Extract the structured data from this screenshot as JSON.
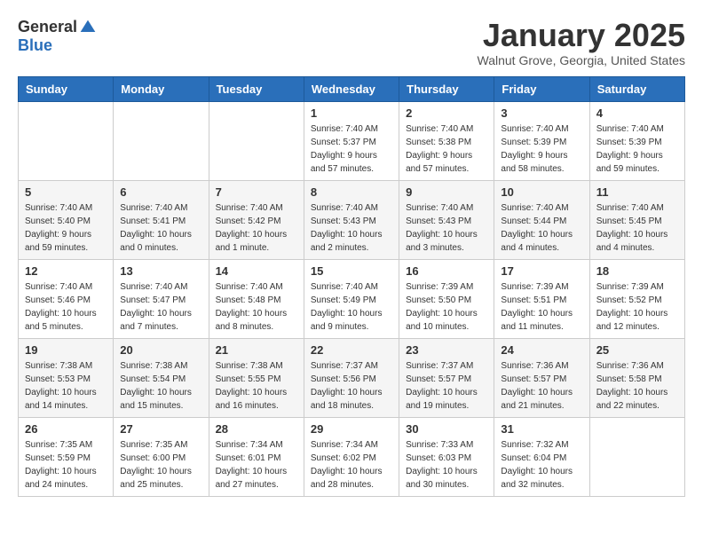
{
  "header": {
    "logo": {
      "general": "General",
      "blue": "Blue"
    },
    "title": "January 2025",
    "location": "Walnut Grove, Georgia, United States"
  },
  "weekdays": [
    "Sunday",
    "Monday",
    "Tuesday",
    "Wednesday",
    "Thursday",
    "Friday",
    "Saturday"
  ],
  "weeks": [
    [
      {
        "day": "",
        "info": ""
      },
      {
        "day": "",
        "info": ""
      },
      {
        "day": "",
        "info": ""
      },
      {
        "day": "1",
        "info": "Sunrise: 7:40 AM\nSunset: 5:37 PM\nDaylight: 9 hours\nand 57 minutes."
      },
      {
        "day": "2",
        "info": "Sunrise: 7:40 AM\nSunset: 5:38 PM\nDaylight: 9 hours\nand 57 minutes."
      },
      {
        "day": "3",
        "info": "Sunrise: 7:40 AM\nSunset: 5:39 PM\nDaylight: 9 hours\nand 58 minutes."
      },
      {
        "day": "4",
        "info": "Sunrise: 7:40 AM\nSunset: 5:39 PM\nDaylight: 9 hours\nand 59 minutes."
      }
    ],
    [
      {
        "day": "5",
        "info": "Sunrise: 7:40 AM\nSunset: 5:40 PM\nDaylight: 9 hours\nand 59 minutes."
      },
      {
        "day": "6",
        "info": "Sunrise: 7:40 AM\nSunset: 5:41 PM\nDaylight: 10 hours\nand 0 minutes."
      },
      {
        "day": "7",
        "info": "Sunrise: 7:40 AM\nSunset: 5:42 PM\nDaylight: 10 hours\nand 1 minute."
      },
      {
        "day": "8",
        "info": "Sunrise: 7:40 AM\nSunset: 5:43 PM\nDaylight: 10 hours\nand 2 minutes."
      },
      {
        "day": "9",
        "info": "Sunrise: 7:40 AM\nSunset: 5:43 PM\nDaylight: 10 hours\nand 3 minutes."
      },
      {
        "day": "10",
        "info": "Sunrise: 7:40 AM\nSunset: 5:44 PM\nDaylight: 10 hours\nand 4 minutes."
      },
      {
        "day": "11",
        "info": "Sunrise: 7:40 AM\nSunset: 5:45 PM\nDaylight: 10 hours\nand 4 minutes."
      }
    ],
    [
      {
        "day": "12",
        "info": "Sunrise: 7:40 AM\nSunset: 5:46 PM\nDaylight: 10 hours\nand 5 minutes."
      },
      {
        "day": "13",
        "info": "Sunrise: 7:40 AM\nSunset: 5:47 PM\nDaylight: 10 hours\nand 7 minutes."
      },
      {
        "day": "14",
        "info": "Sunrise: 7:40 AM\nSunset: 5:48 PM\nDaylight: 10 hours\nand 8 minutes."
      },
      {
        "day": "15",
        "info": "Sunrise: 7:40 AM\nSunset: 5:49 PM\nDaylight: 10 hours\nand 9 minutes."
      },
      {
        "day": "16",
        "info": "Sunrise: 7:39 AM\nSunset: 5:50 PM\nDaylight: 10 hours\nand 10 minutes."
      },
      {
        "day": "17",
        "info": "Sunrise: 7:39 AM\nSunset: 5:51 PM\nDaylight: 10 hours\nand 11 minutes."
      },
      {
        "day": "18",
        "info": "Sunrise: 7:39 AM\nSunset: 5:52 PM\nDaylight: 10 hours\nand 12 minutes."
      }
    ],
    [
      {
        "day": "19",
        "info": "Sunrise: 7:38 AM\nSunset: 5:53 PM\nDaylight: 10 hours\nand 14 minutes."
      },
      {
        "day": "20",
        "info": "Sunrise: 7:38 AM\nSunset: 5:54 PM\nDaylight: 10 hours\nand 15 minutes."
      },
      {
        "day": "21",
        "info": "Sunrise: 7:38 AM\nSunset: 5:55 PM\nDaylight: 10 hours\nand 16 minutes."
      },
      {
        "day": "22",
        "info": "Sunrise: 7:37 AM\nSunset: 5:56 PM\nDaylight: 10 hours\nand 18 minutes."
      },
      {
        "day": "23",
        "info": "Sunrise: 7:37 AM\nSunset: 5:57 PM\nDaylight: 10 hours\nand 19 minutes."
      },
      {
        "day": "24",
        "info": "Sunrise: 7:36 AM\nSunset: 5:57 PM\nDaylight: 10 hours\nand 21 minutes."
      },
      {
        "day": "25",
        "info": "Sunrise: 7:36 AM\nSunset: 5:58 PM\nDaylight: 10 hours\nand 22 minutes."
      }
    ],
    [
      {
        "day": "26",
        "info": "Sunrise: 7:35 AM\nSunset: 5:59 PM\nDaylight: 10 hours\nand 24 minutes."
      },
      {
        "day": "27",
        "info": "Sunrise: 7:35 AM\nSunset: 6:00 PM\nDaylight: 10 hours\nand 25 minutes."
      },
      {
        "day": "28",
        "info": "Sunrise: 7:34 AM\nSunset: 6:01 PM\nDaylight: 10 hours\nand 27 minutes."
      },
      {
        "day": "29",
        "info": "Sunrise: 7:34 AM\nSunset: 6:02 PM\nDaylight: 10 hours\nand 28 minutes."
      },
      {
        "day": "30",
        "info": "Sunrise: 7:33 AM\nSunset: 6:03 PM\nDaylight: 10 hours\nand 30 minutes."
      },
      {
        "day": "31",
        "info": "Sunrise: 7:32 AM\nSunset: 6:04 PM\nDaylight: 10 hours\nand 32 minutes."
      },
      {
        "day": "",
        "info": ""
      }
    ]
  ]
}
